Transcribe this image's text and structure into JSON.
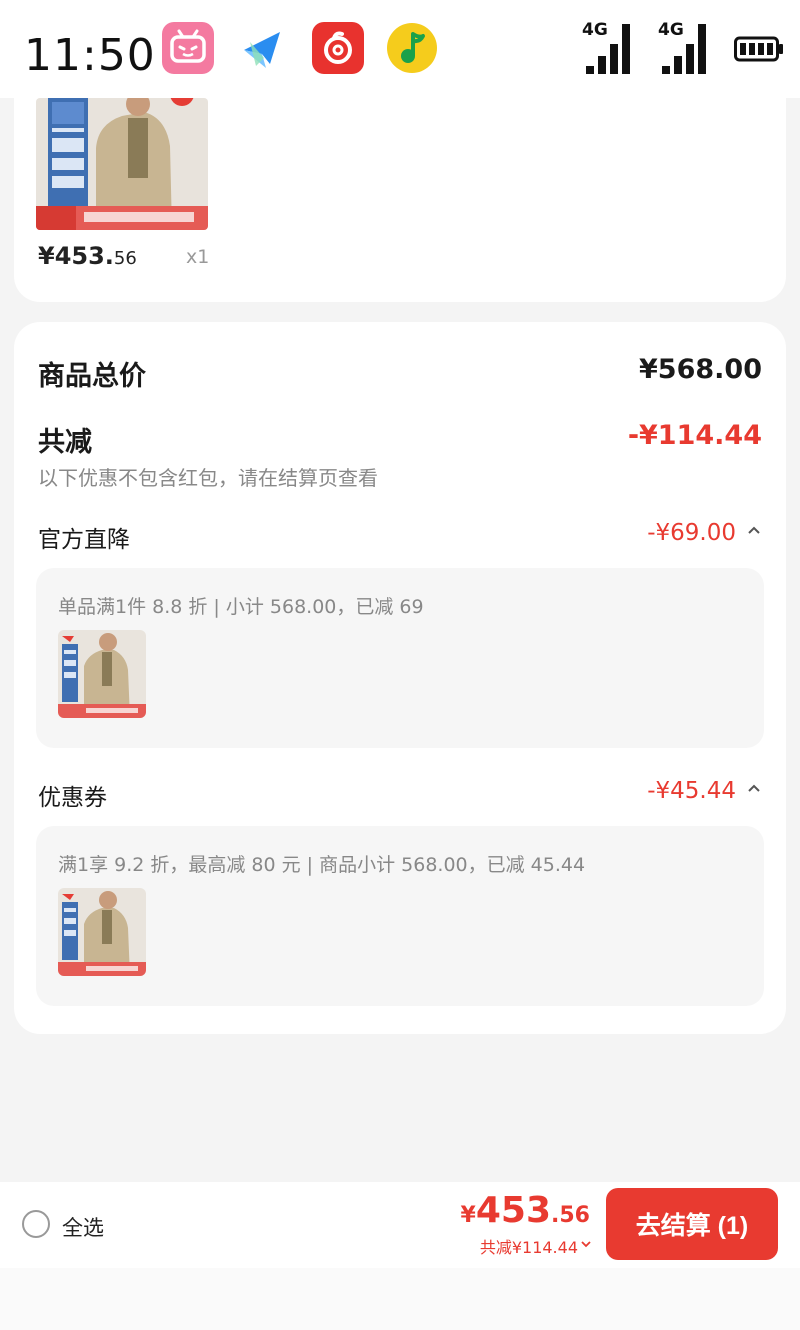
{
  "status_bar": {
    "time": "11:50",
    "apps": [
      "bilibili-icon",
      "paper-plane-icon",
      "netease-music-icon",
      "qq-music-icon"
    ],
    "signal_1_label": "4G",
    "signal_2_label": "4G",
    "battery": "battery-icon"
  },
  "product": {
    "price_int": "¥453.",
    "price_dec": "56",
    "quantity": "x1"
  },
  "summary": {
    "total_label": "商品总价",
    "total_value": "¥568.00",
    "discount_label": "共减",
    "discount_value": "-¥114.44",
    "discount_note": "以下优惠不包含红包，请在结算页查看",
    "official": {
      "label": "官方直降",
      "value": "-¥69.00",
      "detail": "单品满1件 8.8 折 | 小计 568.00，已减 69"
    },
    "coupon": {
      "label": "优惠券",
      "value": "-¥45.44",
      "detail": "满1享 9.2 折，最高减 80 元 | 商品小计 568.00，已减 45.44"
    }
  },
  "bottom_bar": {
    "select_all": "全选",
    "pay_yen": "¥",
    "pay_int": "453",
    "pay_dec": ".56",
    "saved": "共减¥114.44",
    "checkout": "去结算 (1)"
  },
  "colors": {
    "accent": "#e83a30",
    "background": "#f4f4f4",
    "card": "#ffffff",
    "sub_box": "#f6f6f6"
  }
}
